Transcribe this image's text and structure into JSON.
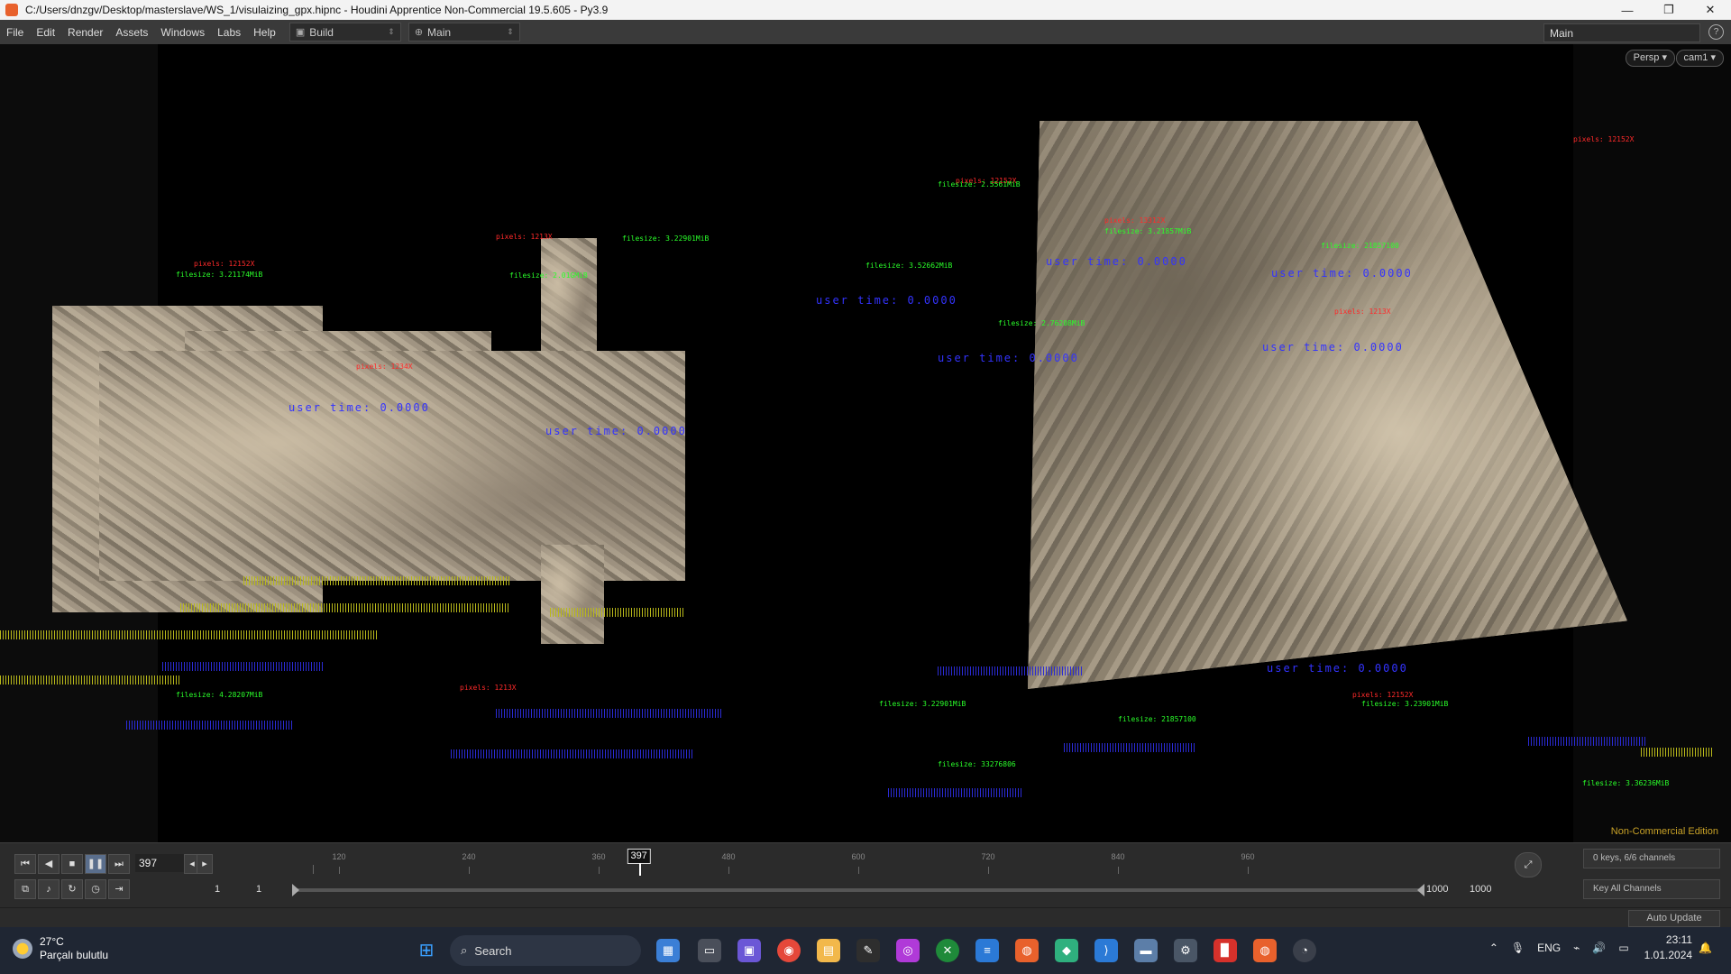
{
  "window": {
    "title": "C:/Users/dnzgv/Desktop/masterslave/WS_1/visulaizing_gpx.hipnc - Houdini Apprentice Non-Commercial 19.5.605 - Py3.9",
    "controls": [
      "—",
      "❐",
      "✕"
    ]
  },
  "menu": {
    "items": [
      "File",
      "Edit",
      "Render",
      "Assets",
      "Windows",
      "Labs",
      "Help"
    ],
    "desktop_build": "Build",
    "desktop_main": "Main",
    "right_desk": "Main"
  },
  "viewport": {
    "persp": "Persp ▾",
    "cam": "cam1 ▾",
    "edition": "Non-Commercial Edition",
    "labels_red": [
      "pixels: 12152X",
      "pixels: 1213X",
      "pixels: 1234X",
      "pixels: 12152X",
      "pixels: 13312X",
      "pixels: 1213X",
      "pixels: 12152X",
      "pixels: 1213X",
      "pixels: 12152X"
    ],
    "labels_green": [
      "filesize: 3.21174MiB",
      "filesize: 3.22901MiB",
      "filesize: 2.01GMiB",
      "filesize: 3.52662MiB",
      "filesize: 2.5561MiB",
      "filesize: 3.21857MiB",
      "filesize: 2.76208MiB",
      "filesize: 21857100",
      "filesize: 33276806",
      "filesize: 3.22901MiB",
      "filesize: 21857100",
      "filesize: 3.23901MiB",
      "filesize: 4.28207MiB",
      "filesize: 3.36236MiB"
    ],
    "labels_blue": [
      "user time: 0.0000",
      "user time: 0.0000",
      "user time: 0.0000",
      "user time: 0.0000",
      "user time: 0.0000",
      "user time: 0.0000",
      "user time: 0.0000",
      "user time: 0.0000"
    ]
  },
  "timeline": {
    "current_frame": "397",
    "ticks": [
      "120",
      "240",
      "360",
      "480",
      "600",
      "720",
      "840",
      "960"
    ],
    "cursor_frame": "397",
    "start1": "1",
    "start2": "1",
    "end1": "1000",
    "end2": "1000",
    "keys_info": "0 keys, 6/6 channels",
    "key_all": "Key All Channels",
    "auto_update": "Auto Update"
  },
  "taskbar": {
    "temperature": "27°C",
    "weather": "Parçalı bulutlu",
    "search": "Search",
    "language": "ENG",
    "time": "23:11",
    "date": "1.01.2024"
  }
}
